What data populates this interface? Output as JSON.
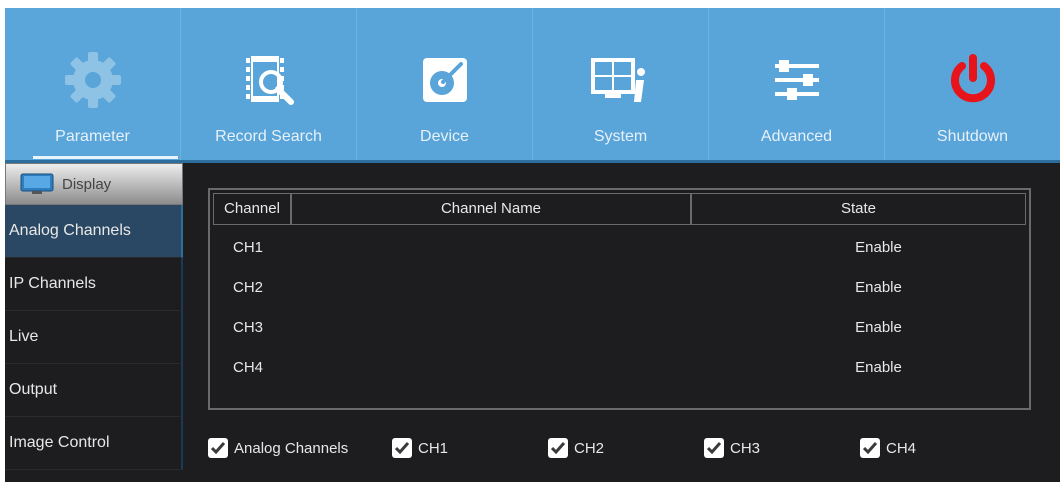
{
  "nav": {
    "items": [
      {
        "label": "Parameter",
        "icon": "gear-icon"
      },
      {
        "label": "Record Search",
        "icon": "record-search-icon"
      },
      {
        "label": "Device",
        "icon": "device-icon"
      },
      {
        "label": "System",
        "icon": "system-info-icon"
      },
      {
        "label": "Advanced",
        "icon": "sliders-icon"
      },
      {
        "label": "Shutdown",
        "icon": "power-icon"
      }
    ],
    "active": "Parameter"
  },
  "sidebar": {
    "header": "Display",
    "items": [
      {
        "label": "Analog Channels"
      },
      {
        "label": "IP Channels"
      },
      {
        "label": "Live"
      },
      {
        "label": "Output"
      },
      {
        "label": "Image Control"
      }
    ]
  },
  "table": {
    "columns": [
      "Channel",
      "Channel Name",
      "State"
    ],
    "rows": [
      {
        "channel": "CH1",
        "name": "",
        "state": "Enable"
      },
      {
        "channel": "CH2",
        "name": "",
        "state": "Enable"
      },
      {
        "channel": "CH3",
        "name": "",
        "state": "Enable"
      },
      {
        "channel": "CH4",
        "name": "",
        "state": "Enable"
      }
    ]
  },
  "checkboxes": [
    {
      "label": "Analog Channels",
      "checked": true
    },
    {
      "label": "CH1",
      "checked": true
    },
    {
      "label": "CH2",
      "checked": true
    },
    {
      "label": "CH3",
      "checked": true
    },
    {
      "label": "CH4",
      "checked": true
    }
  ],
  "colors": {
    "nav_bg": "#59a4d8",
    "content_bg": "#1d1d1f",
    "power_red": "#e8141c",
    "active_side": "#2a4863"
  }
}
